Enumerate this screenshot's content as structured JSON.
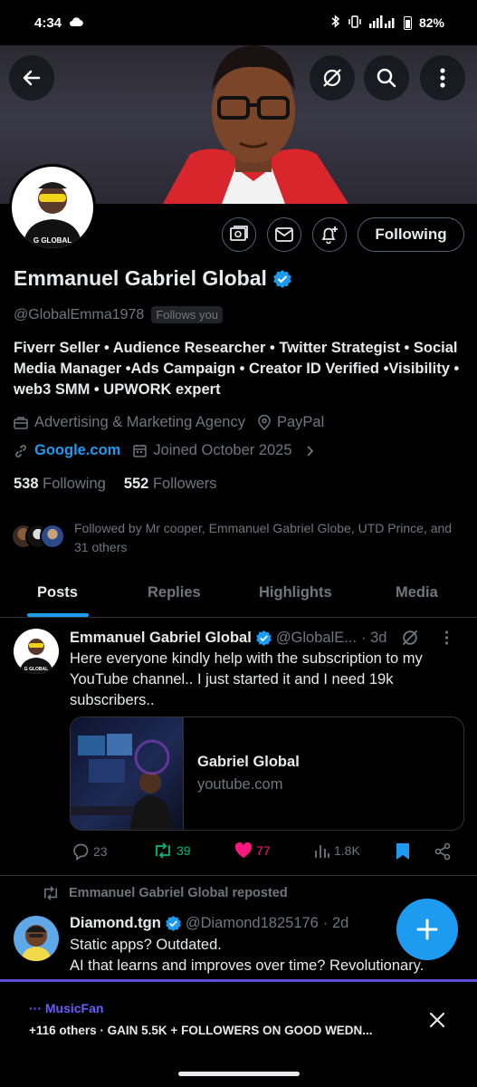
{
  "status_bar": {
    "time": "4:34",
    "battery": "82%"
  },
  "profile": {
    "name": "Emmanuel Gabriel Global",
    "handle": "@GlobalEmma1978",
    "follows_you": "Follows you",
    "bio": "Fiverr Seller • Audience Researcher • Twitter Strategist • Social Media Manager •Ads Campaign • Creator ID Verified •Visibility • web3 SMM • UPWORK expert",
    "category": "Advertising & Marketing Agency",
    "location": "PayPal",
    "website": "Google.com",
    "joined": "Joined October 2025",
    "following_count": "538",
    "following_label": "Following",
    "followers_count": "552",
    "followers_label": "Followers",
    "followed_by": "Followed by Mr cooper, Emmanuel Gabriel Globe, UTD Prince, and 31 others",
    "avatar_text": "G GLOBAL",
    "following_button": "Following"
  },
  "tabs": [
    "Posts",
    "Replies",
    "Highlights",
    "Media"
  ],
  "tweet1": {
    "name": "Emmanuel Gabriel Global",
    "handle": "@GlobalE...",
    "time": "· 3d",
    "text": "Here everyone kindly help with the subscription to my YouTube channel.. I just started it and I need 19k subscribers..",
    "card_title": "Gabriel Global",
    "card_domain": "youtube.com",
    "replies": "23",
    "reposts": "39",
    "likes": "77",
    "views": "1.8K",
    "avatar_text": "G GLOBAL"
  },
  "repost_label": "Emmanuel Gabriel Global reposted",
  "tweet2": {
    "name": "Diamond.tgn",
    "handle": "@Diamond1825176",
    "time": "· 2d",
    "line1": "Static apps? Outdated.",
    "line2": "AI that learns and improves over time? Revolutionary."
  },
  "notification": {
    "title": "··· MusicFan",
    "body": "+116 others · GAIN 5.5K + FOLLOWERS ON GOOD WEDN..."
  },
  "colors": {
    "accent": "#1d9bf0",
    "repost": "#00ba7c",
    "like": "#f91880",
    "bg": "#000000"
  }
}
